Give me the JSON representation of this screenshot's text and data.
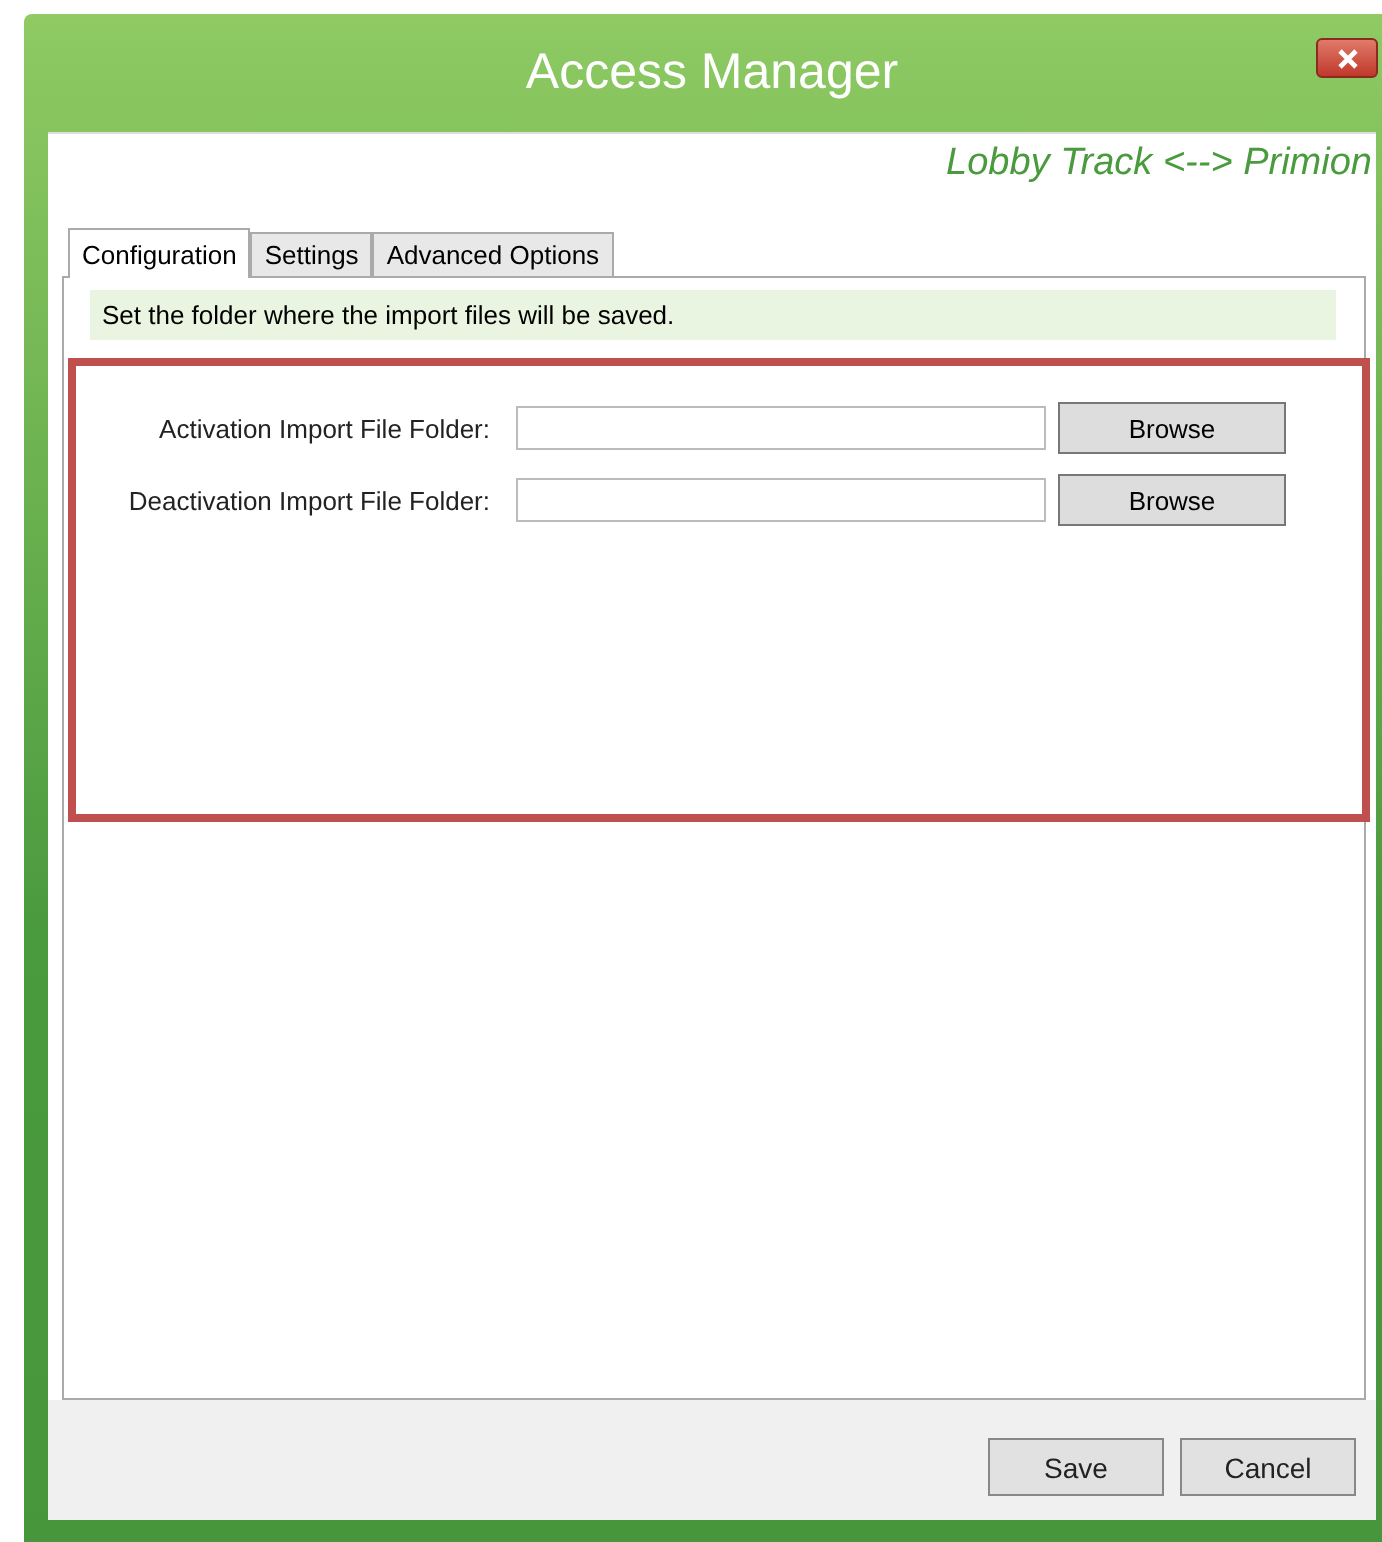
{
  "window": {
    "title": "Access Manager",
    "subtitle": "Lobby Track <--> Primion"
  },
  "tabs": [
    {
      "label": "Configuration",
      "selected": true
    },
    {
      "label": "Settings",
      "selected": false
    },
    {
      "label": "Advanced Options",
      "selected": false
    }
  ],
  "info": "Set the folder where the import files will be saved.",
  "highlighted": true,
  "fields": [
    {
      "label": "Activation Import File Folder:",
      "button": "Browse"
    },
    {
      "label": "Deactivation Import File Folder:",
      "button": "Browse"
    }
  ],
  "buttons": [
    "Save",
    "Cancel"
  ]
}
